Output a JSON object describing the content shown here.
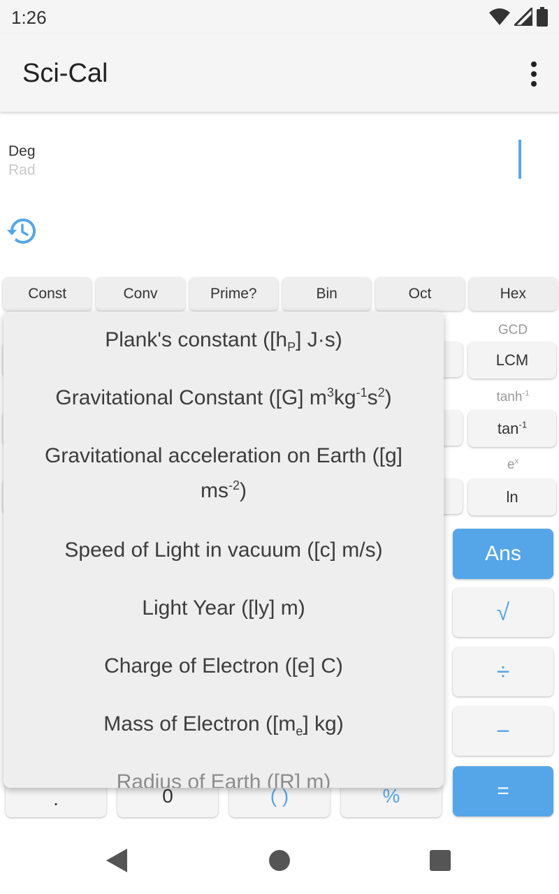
{
  "status_bar": {
    "time": "1:26"
  },
  "app_bar": {
    "title": "Sci-Cal"
  },
  "display": {
    "mode_primary": "Deg",
    "mode_secondary": "Rad"
  },
  "function_row": [
    "Const",
    "Conv",
    "Prime?",
    "Bin",
    "Oct",
    "Hex"
  ],
  "right_column": {
    "gcd_label": "GCD",
    "lcm_label": "LCM",
    "tanh_inv_label": "tanh",
    "tan_inv_label": "tan",
    "inv_sup": "-1",
    "exp_base": "e",
    "exp_sup": "x",
    "ln_label": "ln",
    "ans_label": "Ans",
    "sqrt_label": "√",
    "divide_label": "÷",
    "minus_label": "−",
    "equals_label": "="
  },
  "bottom_row": {
    "dot_label": ".",
    "zero_label": "0",
    "paren_label": "( )",
    "percent_label": "%"
  },
  "constants_menu": {
    "plank_pre": "Plank's constant ([h",
    "plank_sub": "P",
    "plank_post": "] J·s)",
    "grav_pre": "Gravitational Constant ([G] m",
    "grav_sup1": "3",
    "grav_mid1": "kg",
    "grav_sup2": "-1",
    "grav_mid2": "s",
    "grav_sup3": "2",
    "grav_post": ")",
    "accel_pre": "Gravitational acceleration on Earth ([g] ms",
    "accel_sup": "-2",
    "accel_post": ")",
    "light_speed": "Speed of Light in vacuum ([c] m/s)",
    "light_year": "Light Year ([ly] m)",
    "electron_charge": "Charge of Electron ([e] C)",
    "mass_pre": "Mass of Electron ([m",
    "mass_sub": "e",
    "mass_post": "] kg)",
    "radius_pre": "Radius of Earth ([R",
    "radius_post": "] m)"
  },
  "colors": {
    "accent": "#55a6e8",
    "popup_bg": "#eeeeee",
    "button_bg": "#f4f4f4"
  },
  "icons": [
    "wifi-icon",
    "signal-icon",
    "battery-icon",
    "overflow-menu-icon",
    "history-icon",
    "back-icon",
    "home-icon",
    "recents-icon"
  ]
}
